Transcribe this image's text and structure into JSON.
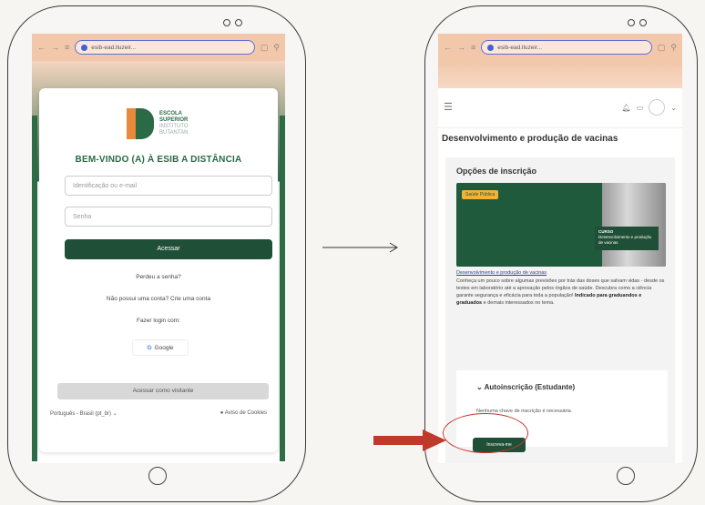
{
  "left_phone": {
    "url": "esib-ead.lluzeir...",
    "logo": {
      "line1": "ESCOLA",
      "line2": "SUPERIOR",
      "line3": "INSTITUTO",
      "line4": "BUTANTAN"
    },
    "welcome": "BEM-VINDO (A) À ESIB A DISTÂNCIA",
    "id_placeholder": "Identificação ou e-mail",
    "password_placeholder": "Senha",
    "login_button": "Acessar",
    "forgot_password": "Perdeu a senha?",
    "no_account": "Não possui uma conta? Crie uma conta",
    "login_with": "Fazer login com:",
    "google_label": "Google",
    "guest_button": "Acessar como visitante",
    "language": "Português - Brasil (pt_br)",
    "cookies": "Aviso de Cookies"
  },
  "right_phone": {
    "url": "esib-ead.lluzeir...",
    "course_title": "Desenvolvimento e produção de vacinas",
    "options_title": "Opções de inscrição",
    "banner_tag": "Saúde Pública",
    "banner_label_title": "CURSO",
    "banner_label_text": "Desenvolvimento e produção de vacinas",
    "course_link": "Desenvolvimento e produção de vacinas",
    "description_1": "Conheça um pouco sobre algumas previsões por trás das doses que salvam vidas - desde os testes em laboratório até a aprovação pelos órgãos de saúde. Descubra como a ciência garante segurança e eficácia para toda a população!",
    "description_bold": "Indicado para graduandos e graduados",
    "description_2": "e demais interessados no tema.",
    "self_enroll_title": "Autoinscrição (Estudante)",
    "self_enroll_note": "Nenhuma chave de inscrição é necessária.",
    "enroll_button": "Inscreva-me"
  },
  "colors": {
    "brand_green": "#1f4f37",
    "accent_orange": "#e9893a",
    "highlight_red": "#c0392b"
  }
}
